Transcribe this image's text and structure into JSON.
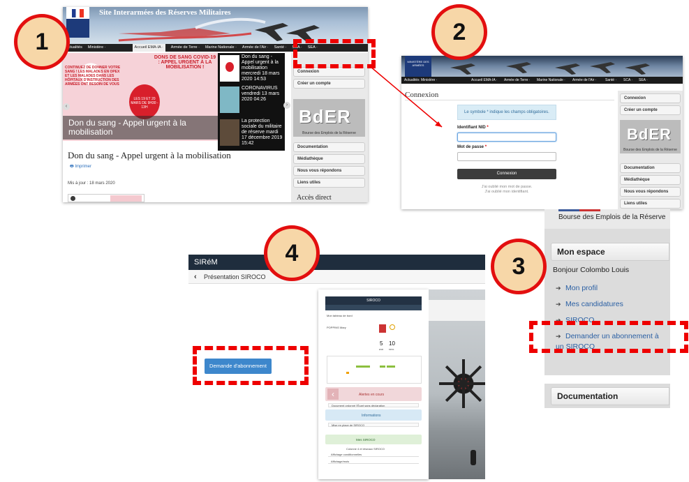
{
  "badges": [
    "1",
    "2",
    "3",
    "4"
  ],
  "accent_color": "#e30f0f",
  "panel1": {
    "site_title": "Site Interarmées des Réserves Militaires",
    "nav": [
      "Actualités",
      "Ministère ·",
      "Accueil EMA-IA ·",
      "Armée de Terre ·",
      "Marine Nationale ·",
      "Armée de l'Air ·",
      "Santé ·",
      "SCA ·",
      "SEA ·"
    ],
    "slide_headline": "DONS DE SANG COVID-19 : APPEL URGENT À LA MOBILISATION !",
    "slide_left_text": "CONTINUEZ DE DONNER VOTRE SANG ! LES MALADES EN OPEX ET LES MALADES DANS LES HÔPITAUX D'INSTRUCTION DES ARMÉES ONT BESOIN DE VOUS",
    "slide_drop_text": "LES 19 ET 20 MARS DE 9H30 - 13H",
    "slide_caption": "Don du sang - Appel urgent à la mobilisation",
    "news": [
      {
        "text": "Don du sang - Appel urgent à la mobilisation mercredi 18 mars 2020 14:53"
      },
      {
        "text": "CORONAVIRUS vendredi 13 mars 2020 04:26"
      },
      {
        "text": "La protection sociale du militaire de réserve mardi 17 décembre 2019 15:42"
      }
    ],
    "article_title": "Don du sang - Appel urgent à la mobilisation",
    "print": "Imprimer",
    "updated": "Mis à jour : 18 mars 2020",
    "sidebar": {
      "connexion": "Connexion",
      "create_account": "Créer un compte",
      "bder_logo": "BdER",
      "bder_sub": "Bourse des Emplois de la Réserve",
      "links": [
        "Documentation",
        "Médiathèque",
        "Nous vous répondons",
        "Liens utiles"
      ],
      "acces": "Accès direct"
    }
  },
  "panel2": {
    "logo_text": "MINISTÈRE DES ARMÉES",
    "nav": [
      "Actualités",
      "Ministère ·",
      "Accueil EMA-IA ·",
      "Armée de Terre ·",
      "Marine Nationale ·",
      "Armée de l'Air ·",
      "Santé ·",
      "SCA ·",
      "SEA ·"
    ],
    "title": "Connexion",
    "info": "Le symbole * indique les champs obligatoires.",
    "id_label": "Identifiant NID",
    "pw_label": "Mot de passe",
    "required": "*",
    "submit": "Connexion",
    "forgot_pw": "J'ai oublié mon mot de passe.",
    "forgot_id": "J'ai oublié mon identifiant.",
    "sidebar": {
      "connexion": "Connexion",
      "create_account": "Créer un compte",
      "bder_logo": "BdER",
      "bder_sub": "Bourse des Emplois de la Réserve",
      "links": [
        "Documentation",
        "Médiathèque",
        "Nous vous répondons",
        "Liens utiles"
      ]
    }
  },
  "panel3": {
    "bder_text": "Bourse des Emplois de la Réserve",
    "mon_espace": "Mon espace",
    "greeting": "Bonjour Colombo Louis",
    "links": [
      "Mon profil",
      "Mes candidatures",
      "SIROCO",
      "Demander un abonnement à un SIROCO"
    ],
    "documentation": "Documentation"
  },
  "panel4": {
    "app_title": "SIRéM",
    "breadcrumb": "Présentation SIROCO",
    "subscribe_button": "Demande d'abonnement",
    "phone": {
      "title": "SIROCO",
      "sub": "Mon tableau de bord",
      "person": "POPPINS Mary",
      "count1": "5",
      "count1_label": "ESR",
      "count2": "10",
      "count2_label": "MISS",
      "alerts_title": "Alertes en cours",
      "alerts_row": "Document ordonné l'Écart sans déclaration",
      "infos_title": "Informations",
      "infos_row": "Mise en place de SIROCO",
      "my_siroco": "Mes SIROCO",
      "siroco_line": "Colonne 4 et réseaux SIROCO",
      "row_a": "Affichage conditionnelles",
      "row_b": "Affichage/mois"
    }
  }
}
